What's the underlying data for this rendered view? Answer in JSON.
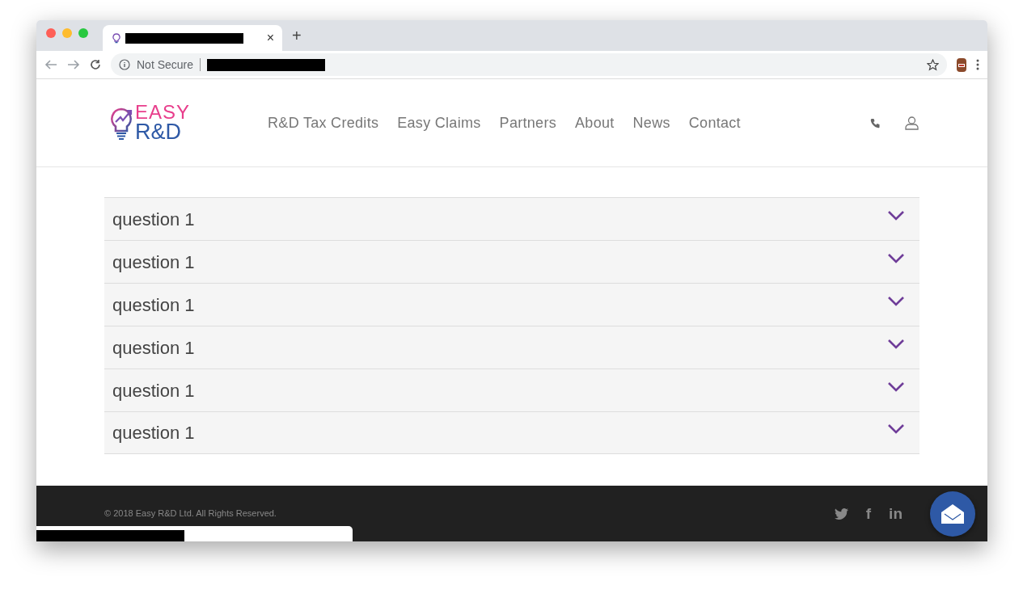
{
  "browser": {
    "tab": {
      "close": "×"
    },
    "new_tab": "+",
    "address": {
      "security": "Not Secure"
    }
  },
  "site": {
    "logo": {
      "line1": "EASY",
      "line2": "R&D"
    },
    "nav": [
      {
        "label": "R&D Tax Credits"
      },
      {
        "label": "Easy Claims"
      },
      {
        "label": "Partners"
      },
      {
        "label": "About"
      },
      {
        "label": "News"
      },
      {
        "label": "Contact"
      }
    ]
  },
  "faq": [
    {
      "question": "question 1",
      "expanded": false
    },
    {
      "question": "question 1",
      "expanded": false
    },
    {
      "question": "question 1",
      "expanded": false
    },
    {
      "question": "question 1",
      "expanded": false
    },
    {
      "question": "question 1",
      "expanded": false
    },
    {
      "question": "question 1",
      "expanded": false
    }
  ],
  "footer": {
    "copyright": "© 2018 Easy R&D Ltd. All Rights Reserved.",
    "social": [
      {
        "kind": "twitter"
      },
      {
        "kind": "text",
        "label": "f"
      },
      {
        "kind": "text",
        "label": "in"
      }
    ]
  }
}
